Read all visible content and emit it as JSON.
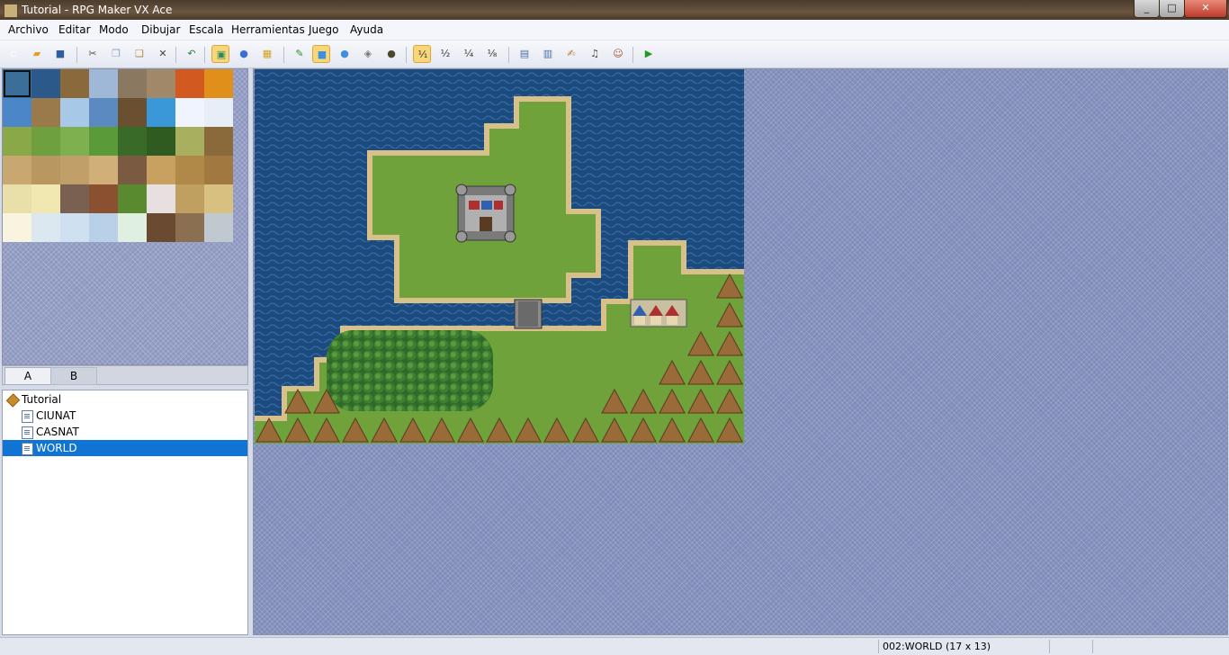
{
  "window": {
    "title": "Tutorial - RPG Maker VX Ace"
  },
  "menu": [
    "Archivo",
    "Editar",
    "Modo",
    "Dibujar",
    "Escala",
    "Herramientas",
    "Juego",
    "Ayuda"
  ],
  "toolbar": {
    "buttons": [
      {
        "name": "new-project-icon",
        "glyph": "▫",
        "color": "#ffffff"
      },
      {
        "name": "open-project-icon",
        "glyph": "▰",
        "color": "#e0a030"
      },
      {
        "name": "save-project-icon",
        "glyph": "■",
        "color": "#2f5e9e"
      },
      {
        "name": "cut-icon",
        "glyph": "✂",
        "color": "#555555"
      },
      {
        "name": "copy-icon",
        "glyph": "❐",
        "color": "#8fa2c8"
      },
      {
        "name": "paste-icon",
        "glyph": "❑",
        "color": "#b58a4a"
      },
      {
        "name": "delete-icon",
        "glyph": "✕",
        "color": "#444444"
      },
      {
        "name": "undo-icon",
        "glyph": "↶",
        "color": "#2a7f3a"
      },
      {
        "name": "map-mode-icon",
        "glyph": "▣",
        "color": "#2e8b57",
        "on": true
      },
      {
        "name": "event-mode-icon",
        "glyph": "●",
        "color": "#3a6fd8"
      },
      {
        "name": "region-mode-icon",
        "glyph": "▦",
        "color": "#d4a020"
      },
      {
        "name": "pencil-icon",
        "glyph": "✎",
        "color": "#2f8f2f"
      },
      {
        "name": "rectangle-icon",
        "glyph": "■",
        "color": "#3d8fe0",
        "on": true
      },
      {
        "name": "ellipse-icon",
        "glyph": "●",
        "color": "#3d8fe0"
      },
      {
        "name": "fill-icon",
        "glyph": "◈",
        "color": "#777777"
      },
      {
        "name": "shadow-pen-icon",
        "glyph": "●",
        "color": "#4a4a2a"
      },
      {
        "name": "zoom-1-1-icon",
        "glyph": "¹⁄₁",
        "color": "#333333",
        "on": true
      },
      {
        "name": "zoom-1-2-icon",
        "glyph": "¹⁄₂",
        "color": "#333333"
      },
      {
        "name": "zoom-1-4-icon",
        "glyph": "¹⁄₄",
        "color": "#333333"
      },
      {
        "name": "zoom-1-8-icon",
        "glyph": "¹⁄₈",
        "color": "#333333"
      },
      {
        "name": "database-icon",
        "glyph": "▤",
        "color": "#4a6fa8"
      },
      {
        "name": "resource-manager-icon",
        "glyph": "▥",
        "color": "#4a6fa8"
      },
      {
        "name": "script-editor-icon",
        "glyph": "✍",
        "color": "#b07a30"
      },
      {
        "name": "sound-test-icon",
        "glyph": "♫",
        "color": "#444444"
      },
      {
        "name": "character-generator-icon",
        "glyph": "☺",
        "color": "#a0522d"
      },
      {
        "name": "playtest-icon",
        "glyph": "▶",
        "color": "#1f9a1f"
      }
    ]
  },
  "palette": {
    "tabs": [
      "A",
      "B"
    ],
    "tiles": [
      "#3b6f9a",
      "#2b5a8a",
      "#8a6a3a",
      "#9fb8d8",
      "#8a7860",
      "#a08868",
      "#d25a20",
      "#e0901a",
      "#4a86c8",
      "#9a7a4a",
      "#a8c8e8",
      "#5a8ac0",
      "#6a5030",
      "#3a98d8",
      "#f0f4ff",
      "#e8eef8",
      "#8aa848",
      "#6fa040",
      "#7fb050",
      "#5a9a38",
      "#3a6a28",
      "#2f5a20",
      "#a8b060",
      "#8a6a3a",
      "#c8a870",
      "#b89860",
      "#c0a068",
      "#d0b078",
      "#7a5a40",
      "#c8a060",
      "#b08848",
      "#a07840",
      "#e8e0a8",
      "#f0e8b0",
      "#7a6050",
      "#8a5030",
      "#5a8a30",
      "#e8e0e0",
      "#c0a060",
      "#d8c080",
      "#f8f4e0",
      "#dce8f0",
      "#cfe0f0",
      "#b8d0e8",
      "#e0f0e0",
      "#6a4a30",
      "#8a7050",
      "#c0c8d0"
    ],
    "selected_index": 0
  },
  "map_tree": {
    "project": "Tutorial",
    "maps": [
      "CIUNAT",
      "CASNAT",
      "WORLD"
    ],
    "selected": "WORLD"
  },
  "map": {
    "colors": {
      "sea": "#1c4b80",
      "grass": "#6fa23a",
      "sand": "#d8c08a",
      "forest": "#2f6a2a",
      "mountain": "#9a6a3a"
    }
  },
  "status": {
    "map_info": "002:WORLD (17 x 13)"
  }
}
